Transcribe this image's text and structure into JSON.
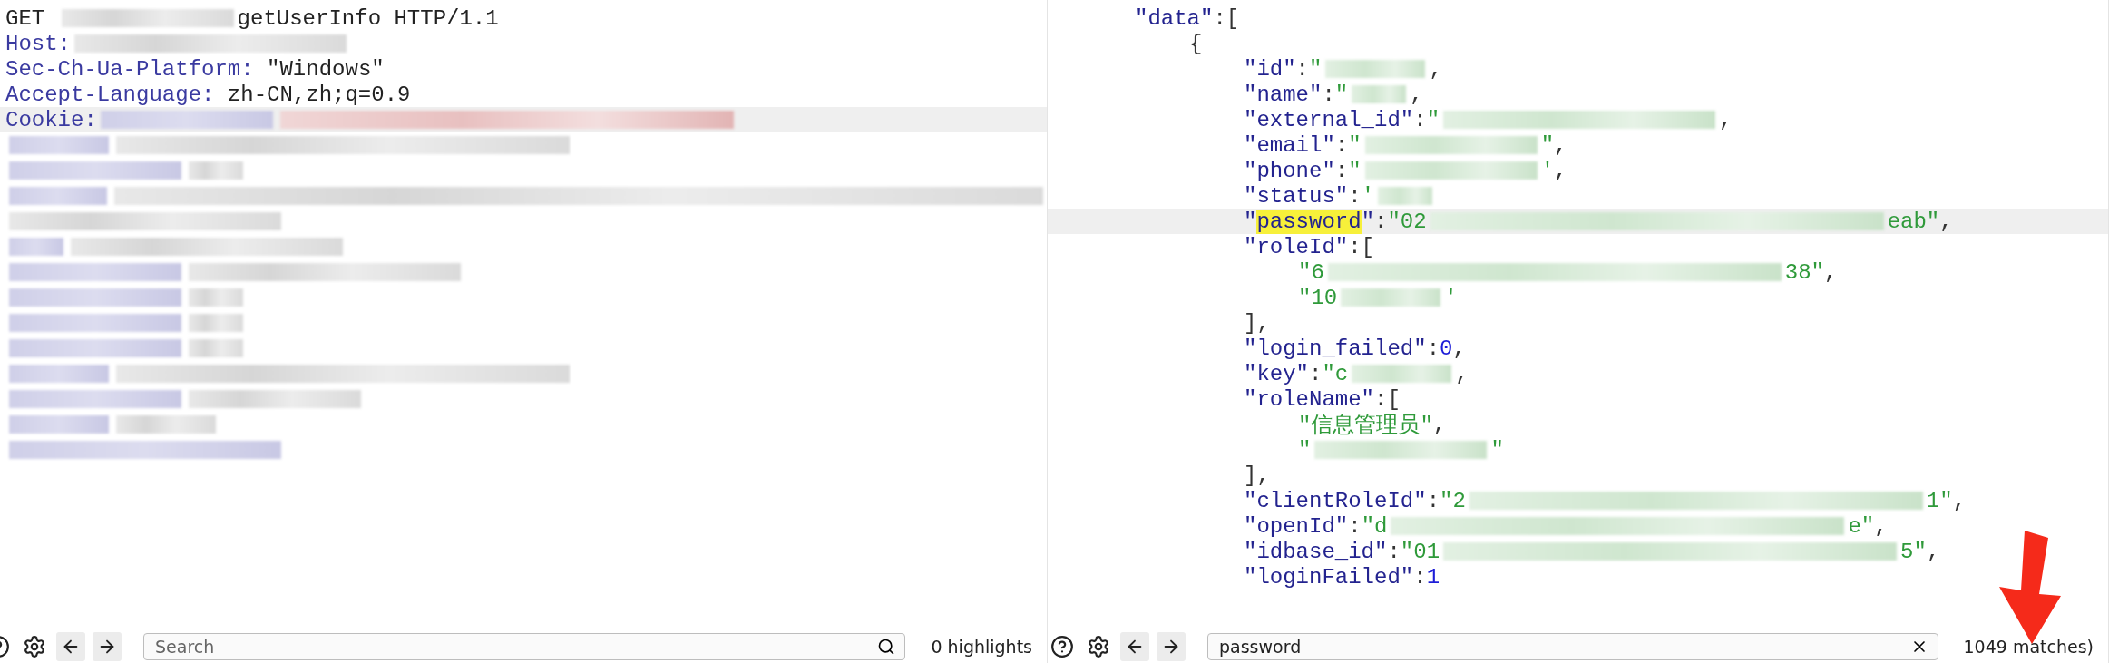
{
  "request": {
    "lines": [
      {
        "current": false,
        "tokens": [
          {
            "kind": "plain",
            "text": "GET "
          },
          {
            "kind": "redacted-m"
          },
          {
            "kind": "plain",
            "text": "getUserInfo HTTP/1.1"
          }
        ]
      },
      {
        "current": false,
        "tokens": [
          {
            "kind": "name",
            "text": "Host:"
          },
          {
            "kind": "redacted-l"
          }
        ]
      },
      {
        "current": false,
        "tokens": [
          {
            "kind": "name",
            "text": "Sec-Ch-Ua-Platform:"
          },
          {
            "kind": "plain",
            "text": " \"Windows\""
          }
        ]
      },
      {
        "current": false,
        "tokens": [
          {
            "kind": "name",
            "text": "Accept-Language:"
          },
          {
            "kind": "plain",
            "text": " zh-CN,zh;q=0.9"
          }
        ]
      },
      {
        "current": true,
        "tokens": [
          {
            "kind": "name",
            "text": "Cookie:"
          },
          {
            "kind": "redactedname-m"
          },
          {
            "kind": "redactedcookie-xl"
          }
        ]
      },
      {
        "current": false,
        "tokens": [
          {
            "kind": "redactedname-s"
          },
          {
            "kind": "redacted-xl"
          }
        ]
      },
      {
        "current": false,
        "tokens": [
          {
            "kind": "redactedname-m"
          },
          {
            "kind": "redacted-xs"
          }
        ]
      },
      {
        "current": false,
        "tokens": [
          {
            "kind": "redactedname-s"
          },
          {
            "kind": "redacted-xxl"
          }
        ]
      },
      {
        "current": false,
        "tokens": [
          {
            "kind": "redacted-l"
          }
        ]
      },
      {
        "current": false,
        "tokens": [
          {
            "kind": "redactedname-xs"
          },
          {
            "kind": "redacted-l"
          }
        ]
      },
      {
        "current": false,
        "tokens": [
          {
            "kind": "redactedname-m"
          },
          {
            "kind": "redacted-l"
          }
        ]
      },
      {
        "current": false,
        "tokens": [
          {
            "kind": "redactedname-m"
          },
          {
            "kind": "redacted-xs"
          }
        ]
      },
      {
        "current": false,
        "tokens": [
          {
            "kind": "redactedname-m"
          },
          {
            "kind": "redacted-xs"
          }
        ]
      },
      {
        "current": false,
        "tokens": [
          {
            "kind": "redactedname-m"
          },
          {
            "kind": "redacted-xs"
          }
        ]
      },
      {
        "current": false,
        "tokens": [
          {
            "kind": "redactedname-s"
          },
          {
            "kind": "redacted-xl"
          }
        ]
      },
      {
        "current": false,
        "tokens": [
          {
            "kind": "redactedname-m"
          },
          {
            "kind": "redacted-m"
          }
        ]
      },
      {
        "current": false,
        "tokens": [
          {
            "kind": "redactedname-s"
          },
          {
            "kind": "redacted-s"
          }
        ]
      },
      {
        "current": false,
        "tokens": [
          {
            "kind": "redactedname-l"
          }
        ]
      }
    ]
  },
  "response": {
    "lines": [
      {
        "current": false,
        "tokens": [
          {
            "kind": "key",
            "text": "\"data\""
          },
          {
            "kind": "punct",
            "text": ":["
          }
        ],
        "children": [
          {
            "current": false,
            "tokens": [
              {
                "kind": "punct",
                "text": "{"
              }
            ],
            "children": [
              {
                "current": false,
                "tokens": [
                  {
                    "kind": "key",
                    "text": "\"id\""
                  },
                  {
                    "kind": "punct",
                    "text": ":"
                  },
                  {
                    "kind": "str",
                    "text": "\""
                  },
                  {
                    "kind": "redacted-s"
                  },
                  {
                    "kind": "punct",
                    "text": ","
                  }
                ]
              },
              {
                "current": false,
                "tokens": [
                  {
                    "kind": "key",
                    "text": "\"name\""
                  },
                  {
                    "kind": "punct",
                    "text": ":"
                  },
                  {
                    "kind": "str",
                    "text": "\""
                  },
                  {
                    "kind": "redacted-xs"
                  },
                  {
                    "kind": "punct",
                    "text": ","
                  }
                ]
              },
              {
                "current": false,
                "tokens": [
                  {
                    "kind": "key",
                    "text": "\"external_id\""
                  },
                  {
                    "kind": "punct",
                    "text": ":"
                  },
                  {
                    "kind": "str",
                    "text": "\""
                  },
                  {
                    "kind": "redacted-l"
                  },
                  {
                    "kind": "punct",
                    "text": ","
                  }
                ]
              },
              {
                "current": false,
                "tokens": [
                  {
                    "kind": "key",
                    "text": "\"email\""
                  },
                  {
                    "kind": "punct",
                    "text": ":"
                  },
                  {
                    "kind": "str",
                    "text": "\""
                  },
                  {
                    "kind": "redacted-m"
                  },
                  {
                    "kind": "str",
                    "text": "\""
                  },
                  {
                    "kind": "punct",
                    "text": ","
                  }
                ]
              },
              {
                "current": false,
                "tokens": [
                  {
                    "kind": "key",
                    "text": "\"phone\""
                  },
                  {
                    "kind": "punct",
                    "text": ":"
                  },
                  {
                    "kind": "str",
                    "text": "\""
                  },
                  {
                    "kind": "redacted-m"
                  },
                  {
                    "kind": "str",
                    "text": "'"
                  },
                  {
                    "kind": "punct",
                    "text": ","
                  }
                ]
              },
              {
                "current": false,
                "tokens": [
                  {
                    "kind": "key",
                    "text": "\"status\""
                  },
                  {
                    "kind": "punct",
                    "text": ":"
                  },
                  {
                    "kind": "str",
                    "text": "'"
                  },
                  {
                    "kind": "redacted-xs"
                  }
                ]
              },
              {
                "current": true,
                "tokens": [
                  {
                    "kind": "key",
                    "text": "\""
                  },
                  {
                    "kind": "match",
                    "text": "password"
                  },
                  {
                    "kind": "key",
                    "text": "\""
                  },
                  {
                    "kind": "punct",
                    "text": ":"
                  },
                  {
                    "kind": "str",
                    "text": "\"02"
                  },
                  {
                    "kind": "redacted-xl"
                  },
                  {
                    "kind": "str",
                    "text": "eab\""
                  },
                  {
                    "kind": "punct",
                    "text": ","
                  }
                ]
              },
              {
                "current": false,
                "tokens": [
                  {
                    "kind": "key",
                    "text": "\"roleId\""
                  },
                  {
                    "kind": "punct",
                    "text": ":["
                  }
                ],
                "children": [
                  {
                    "current": false,
                    "tokens": [
                      {
                        "kind": "str",
                        "text": "\"6"
                      },
                      {
                        "kind": "redacted-xl"
                      },
                      {
                        "kind": "str",
                        "text": "38\""
                      },
                      {
                        "kind": "punct",
                        "text": ","
                      }
                    ]
                  },
                  {
                    "current": false,
                    "tokens": [
                      {
                        "kind": "str",
                        "text": "\"10"
                      },
                      {
                        "kind": "redacted-s"
                      },
                      {
                        "kind": "str",
                        "text": "'"
                      }
                    ]
                  }
                ]
              },
              {
                "current": false,
                "tokens": [
                  {
                    "kind": "punct",
                    "text": "],"
                  }
                ]
              },
              {
                "current": false,
                "tokens": [
                  {
                    "kind": "key",
                    "text": "\"login_failed\""
                  },
                  {
                    "kind": "punct",
                    "text": ":"
                  },
                  {
                    "kind": "num",
                    "text": "0"
                  },
                  {
                    "kind": "punct",
                    "text": ","
                  }
                ]
              },
              {
                "current": false,
                "tokens": [
                  {
                    "kind": "key",
                    "text": "\"key\""
                  },
                  {
                    "kind": "punct",
                    "text": ":"
                  },
                  {
                    "kind": "str",
                    "text": "\"c"
                  },
                  {
                    "kind": "redacted-s"
                  },
                  {
                    "kind": "punct",
                    "text": ","
                  }
                ]
              },
              {
                "current": false,
                "tokens": [
                  {
                    "kind": "key",
                    "text": "\"roleName\""
                  },
                  {
                    "kind": "punct",
                    "text": ":["
                  }
                ],
                "children": [
                  {
                    "current": false,
                    "tokens": [
                      {
                        "kind": "str",
                        "text": "\"信息管理员\""
                      },
                      {
                        "kind": "punct",
                        "text": ","
                      }
                    ]
                  },
                  {
                    "current": false,
                    "tokens": [
                      {
                        "kind": "str",
                        "text": "\""
                      },
                      {
                        "kind": "redacted-m"
                      },
                      {
                        "kind": "str",
                        "text": "\""
                      }
                    ]
                  }
                ]
              },
              {
                "current": false,
                "tokens": [
                  {
                    "kind": "punct",
                    "text": "],"
                  }
                ]
              },
              {
                "current": false,
                "tokens": [
                  {
                    "kind": "key",
                    "text": "\"clientRoleId\""
                  },
                  {
                    "kind": "punct",
                    "text": ":"
                  },
                  {
                    "kind": "str",
                    "text": "\"2"
                  },
                  {
                    "kind": "redacted-xl"
                  },
                  {
                    "kind": "str",
                    "text": "1\""
                  },
                  {
                    "kind": "punct",
                    "text": ","
                  }
                ]
              },
              {
                "current": false,
                "tokens": [
                  {
                    "kind": "key",
                    "text": "\"openId\""
                  },
                  {
                    "kind": "punct",
                    "text": ":"
                  },
                  {
                    "kind": "str",
                    "text": "\"d"
                  },
                  {
                    "kind": "redacted-xl"
                  },
                  {
                    "kind": "str",
                    "text": "e\""
                  },
                  {
                    "kind": "punct",
                    "text": ","
                  }
                ]
              },
              {
                "current": false,
                "tokens": [
                  {
                    "kind": "key",
                    "text": "\"idbase_id\""
                  },
                  {
                    "kind": "punct",
                    "text": ":"
                  },
                  {
                    "kind": "str",
                    "text": "\"01"
                  },
                  {
                    "kind": "redacted-xl"
                  },
                  {
                    "kind": "str",
                    "text": "5\""
                  },
                  {
                    "kind": "punct",
                    "text": ","
                  }
                ]
              },
              {
                "current": false,
                "tokens": [
                  {
                    "kind": "key",
                    "text": "\"loginFailed\""
                  },
                  {
                    "kind": "punct",
                    "text": ":"
                  },
                  {
                    "kind": "num",
                    "text": "1"
                  }
                ]
              }
            ]
          }
        ]
      }
    ]
  },
  "left_bar": {
    "search": {
      "placeholder": "Search"
    },
    "status": "0 highlights"
  },
  "right_bar": {
    "search": {
      "value": "password"
    },
    "status": "1049 matches)"
  }
}
